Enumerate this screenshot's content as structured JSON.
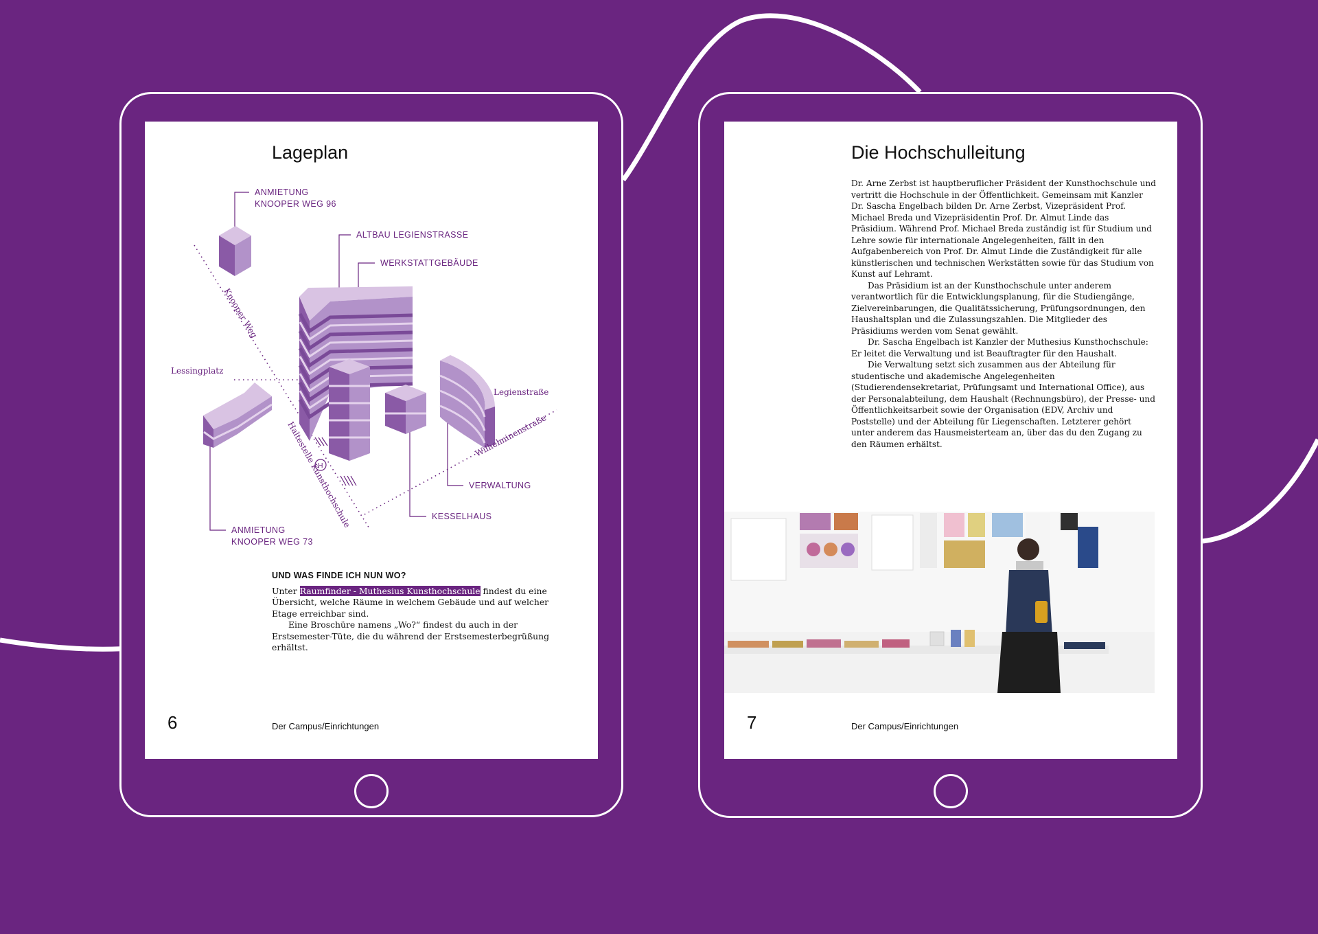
{
  "colors": {
    "brand": "#6a2580",
    "screen": "#ffffff",
    "building_light": "#d9c3e3",
    "building_mid": "#a77fbe",
    "building_dark": "#8a5aa6"
  },
  "left_page": {
    "title": "Lageplan",
    "map": {
      "labels": {
        "anmietung_96_line1": "ANMIETUNG",
        "anmietung_96_line2": "KNOOPER WEG 96",
        "altbau": "ALTBAU LEGIENSTRASSE",
        "werkstatt": "WERKSTATTGEBÄUDE",
        "verwaltung": "VERWALTUNG",
        "kesselhaus": "KESSELHAUS",
        "anmietung_73_line1": "ANMIETUNG",
        "anmietung_73_line2": "KNOOPER WEG 73"
      },
      "streets": {
        "knooper_weg": "Knooper Weg",
        "lessingplatz": "Lessingplatz",
        "legienstrasse": "Legienstraße",
        "wilhelminenstrasse": "Wilhelminenstraße",
        "haltestelle": "Haltestelle Kunsthochschule",
        "bus_stop_symbol": "H"
      }
    },
    "section_heading": "UND WAS FINDE ICH NUN WO?",
    "body": {
      "p1_before": "Unter ",
      "p1_link": "Raumfinder - Muthesius Kunsthochschule",
      "p1_after": " findest du eine Übersicht, welche Räume in welchem Gebäude und auf welcher Etage erreichbar sind.",
      "p2": "Eine Broschüre namens „Wo?“ findest du auch in der Erstsemester-Tüte, die du während der Erstsemesterbegrüßung erhältst."
    },
    "page_number": "6",
    "footer": "Der Campus/Einrichtungen"
  },
  "right_page": {
    "title": "Die Hochschulleitung",
    "paragraphs": [
      "Dr. Arne Zerbst ist hauptberuflicher Präsident der Kunsthochschule und vertritt die Hochschule in der Öffentlichkeit. Gemeinsam mit Kanzler Dr. Sascha Engelbach bilden Dr. Arne Zerbst, Vizepräsident Prof. Michael Breda und Vizepräsidentin Prof. Dr. Almut Linde das Präsidium. Während Prof. Michael Breda zuständig ist für Studium und Lehre sowie für internationale Angelegenheiten, fällt in den Aufgabenbereich von Prof. Dr. Almut Linde die Zuständigkeit für alle künstlerischen und technischen Werkstätten sowie für das Studium von Kunst auf Lehramt.",
      "Das Präsidium ist an der Kunsthochschule unter anderem verantwortlich für die Entwicklungsplanung, für die Studiengänge, Zielvereinbarungen, die Qualitätssicherung, Prüfungsordnungen, den Haushaltsplan und die Zulassungszahlen. Die Mitglieder des Präsidiums werden vom Senat gewählt.",
      "Dr. Sascha Engelbach ist Kanzler der Muthesius Kunsthochschule: Er leitet die Verwaltung und ist Beauftragter für den Haushalt.",
      "Die Verwaltung setzt sich zusammen aus der Abteilung für studentische und akademische Angelegenheiten (Studierendensekretariat, Prüfungsamt und International Office), aus der Personalabteilung, dem Haushalt (Rechnungsbüro), der Presse- und Öffentlichkeitsarbeit sowie der Organisation (EDV, Archiv und Poststelle) und der Abteilung für Liegenschaften. Letzterer gehört unter anderem das Hausmeisterteam an, über das du den Zugang zu den Räumen erhältst."
    ],
    "page_number": "7",
    "footer": "Der Campus/Einrichtungen"
  }
}
